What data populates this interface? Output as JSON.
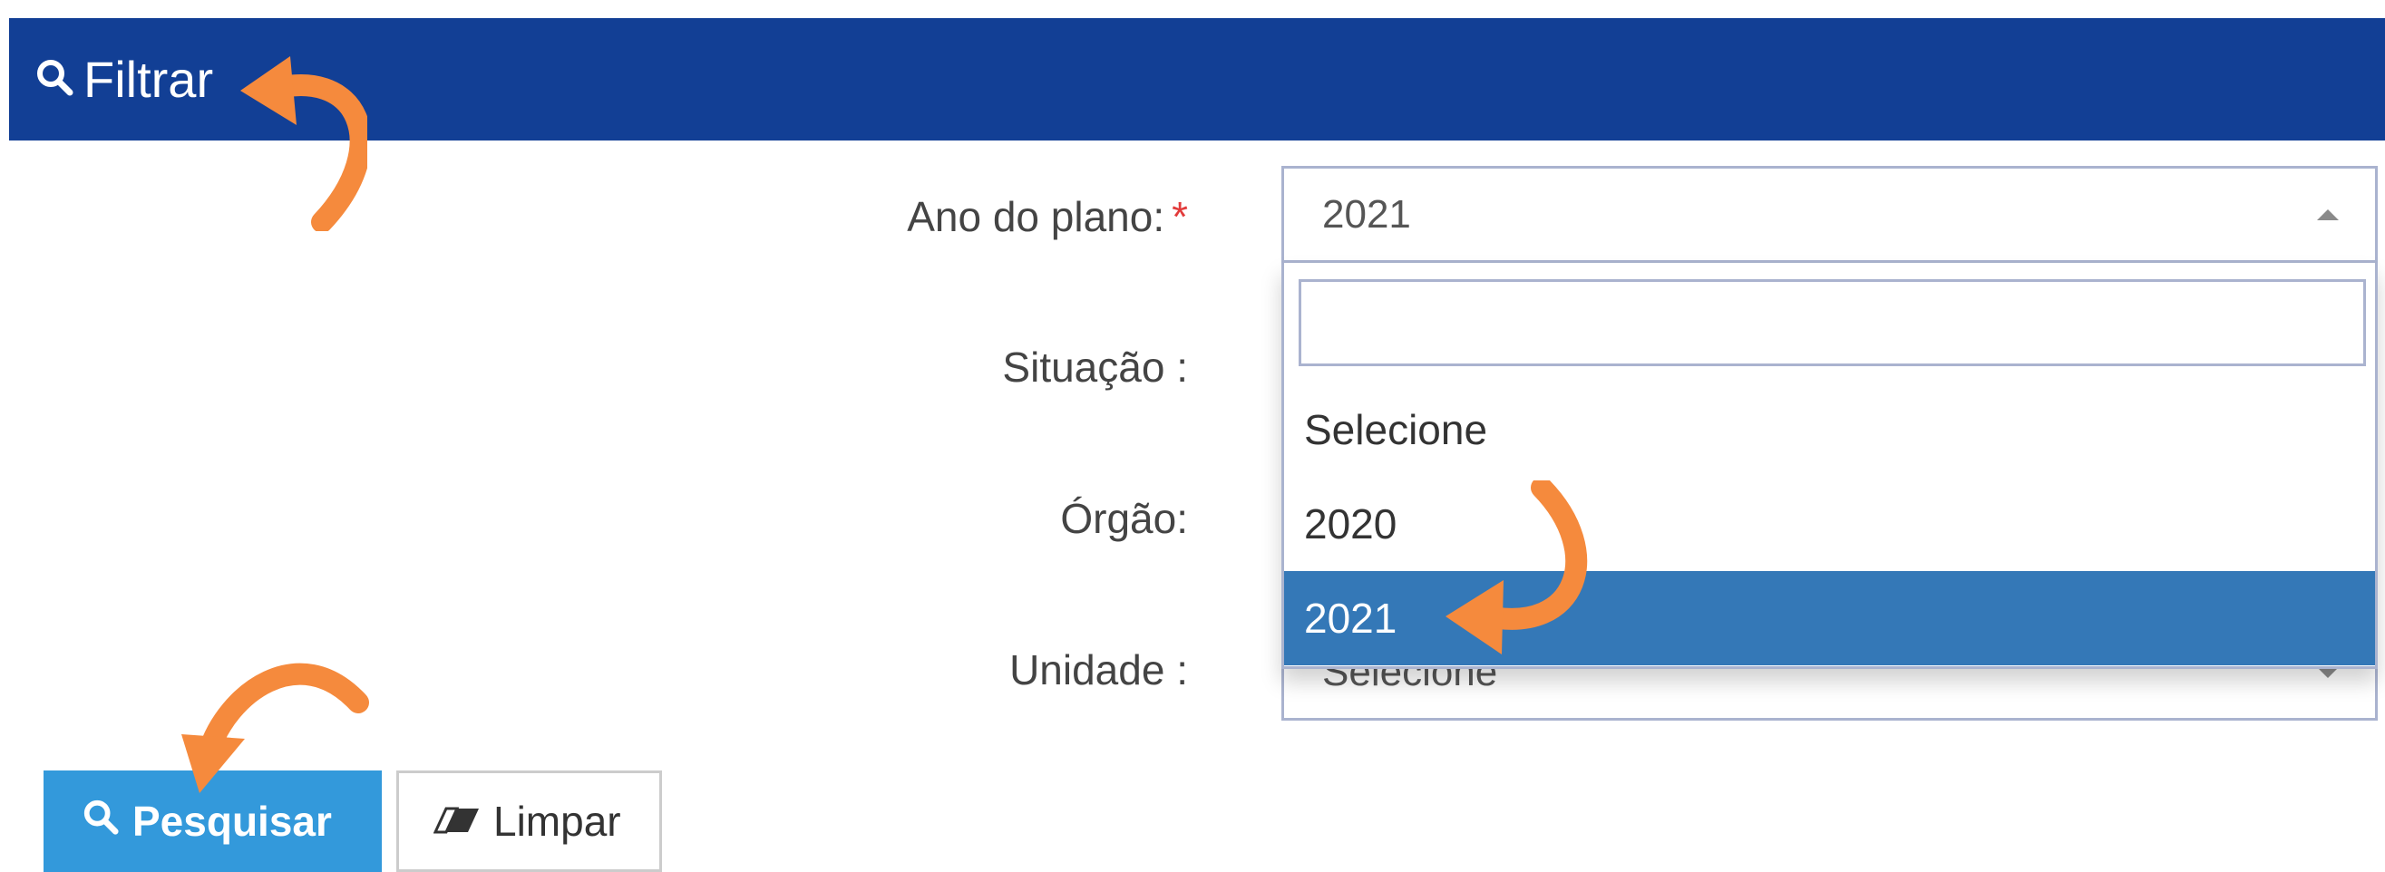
{
  "header": {
    "title": "Filtrar",
    "icon": "search-icon"
  },
  "form": {
    "ano_label": "Ano do plano:",
    "required_mark": "*",
    "ano_value": "2021",
    "situacao_label": "Situação :",
    "orgao_label": "Órgão:",
    "unidade_label": "Unidade :",
    "unidade_value": "Selecione"
  },
  "dropdown": {
    "search_placeholder": "",
    "options": [
      {
        "label": "Selecione"
      },
      {
        "label": "2020"
      },
      {
        "label": "2021",
        "selected": true
      }
    ]
  },
  "buttons": {
    "search_label": "Pesquisar",
    "clear_label": "Limpar"
  },
  "colors": {
    "header_bg": "#123f95",
    "selected_option_bg": "#3478b7",
    "primary_button_bg": "#3399db",
    "annotation_arrow": "#f58a3d",
    "required_asterisk": "#e23b3b"
  }
}
